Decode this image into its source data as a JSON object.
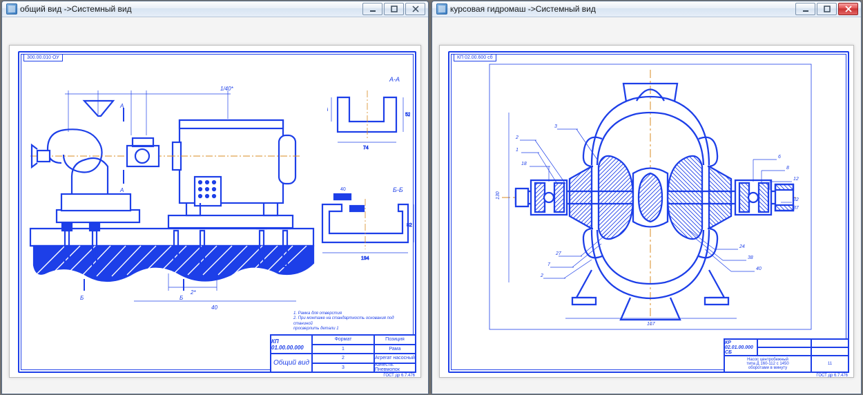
{
  "windows": [
    {
      "key": "w1",
      "title": "общий вид ->Системный вид",
      "close_red": false,
      "sheet": {
        "corner_tag": "300.00.010 ОУ",
        "section_labels": {
          "a": "А-А",
          "b": "Б-Б",
          "marker_a1": "А",
          "marker_a2": "А",
          "marker_b1": "Б",
          "marker_b2": "Б"
        },
        "notes_line1": "1.  Рамка для отверстия",
        "notes_line2": "2.  При монтаже на стандартность основания под станиной",
        "notes_line3": "просверлить детали 1",
        "title_block": {
          "r1c1": "Формат",
          "r1c2": "Позиция",
          "r1c3": "КП 01.00.00.000",
          "r2c1": "1",
          "r2c2": "Рама",
          "r3c1": "2",
          "r3c2": "Агрегат насосный",
          "r4c1": "3",
          "r4c2": "Качеств. Пневмопок",
          "big": "Общий вид",
          "footer": "ГОСТ др 6.7.476"
        }
      }
    },
    {
      "key": "w2",
      "title": "курсовая гидромаш ->Системный вид",
      "close_red": true,
      "sheet": {
        "corner_tag": "КП 02.00.600 сб",
        "title_block": {
          "r1c3": "КР 02.01.00.000 СБ",
          "big_line1": "Насос центробежный",
          "big_line2": "типа Д 160-112 с 1450",
          "big_line3": "оборотами в минуту",
          "footer": "ГОСТ др 6.7.476"
        }
      }
    }
  ]
}
